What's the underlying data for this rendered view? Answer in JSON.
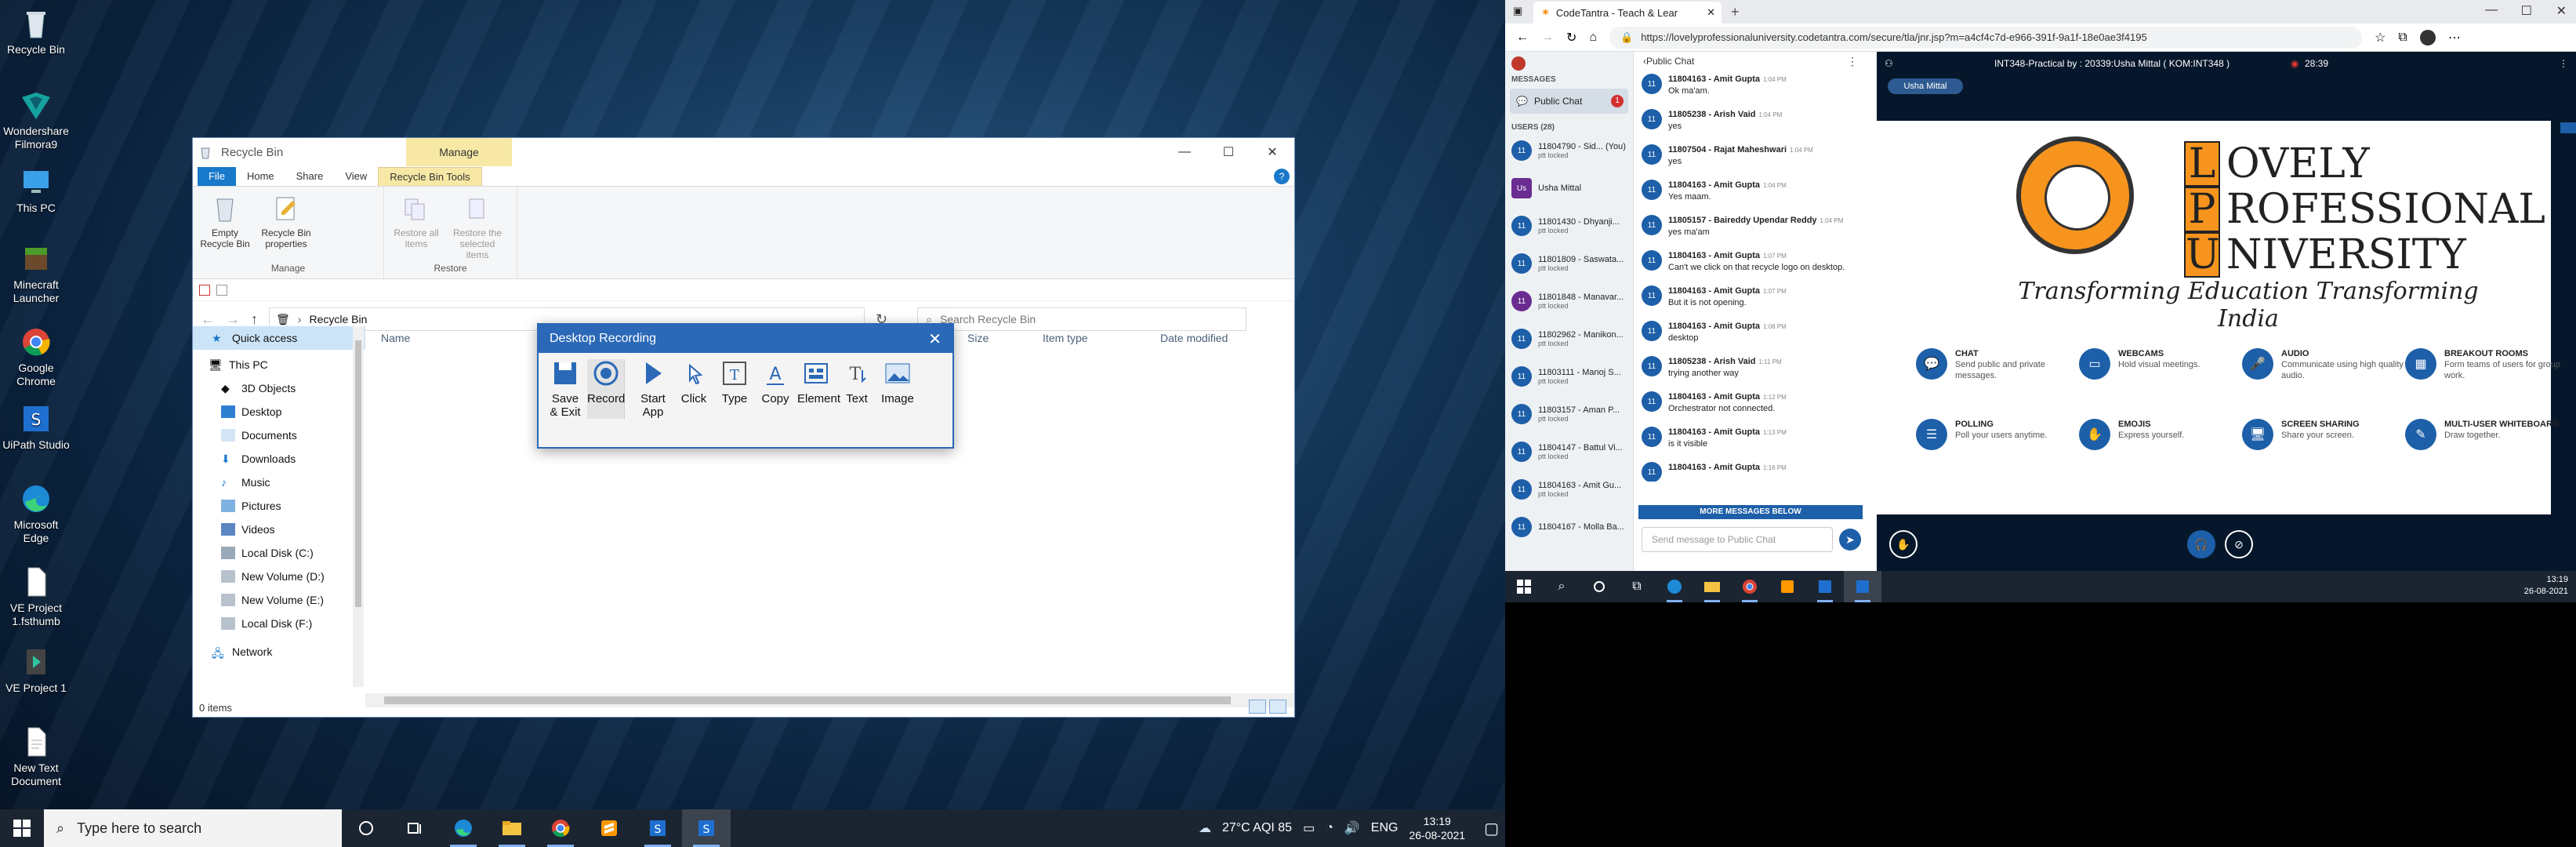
{
  "desktop": {
    "icons": [
      {
        "label": "Recycle Bin"
      },
      {
        "label": "Wondershare Filmora9"
      },
      {
        "label": "This PC"
      },
      {
        "label": "Minecraft Launcher"
      },
      {
        "label": "Google Chrome"
      },
      {
        "label": "UiPath Studio"
      },
      {
        "label": "Microsoft Edge"
      },
      {
        "label": "VE Project 1.fsthumb"
      },
      {
        "label": "VE Project 1"
      },
      {
        "label": "New Text Document"
      }
    ]
  },
  "explorer": {
    "title": "Recycle Bin",
    "manage_tab": "Manage",
    "tabs": [
      "File",
      "Home",
      "Share",
      "View",
      "Recycle Bin Tools"
    ],
    "ribbon": {
      "manage_group": {
        "label": "Manage",
        "empty": "Empty Recycle Bin",
        "props": "Recycle Bin properties"
      },
      "restore_group": {
        "label": "Restore",
        "restore_all": "Restore all items",
        "restore_sel": "Restore the selected items"
      }
    },
    "address": "Recycle Bin",
    "search_placeholder": "Search Recycle Bin",
    "nav": [
      "Quick access",
      "This PC",
      "3D Objects",
      "Desktop",
      "Documents",
      "Downloads",
      "Music",
      "Pictures",
      "Videos",
      "Local Disk (C:)",
      "New Volume (D:)",
      "New Volume (E:)",
      "Local Disk (F:)",
      "Network"
    ],
    "columns": [
      "Name",
      "Size",
      "Item type",
      "Date modified"
    ],
    "status": "0 items"
  },
  "recorder": {
    "title": "Desktop Recording",
    "tools": [
      "Save & Exit",
      "Record",
      "Start App",
      "Click",
      "Type",
      "Copy",
      "Element",
      "Text",
      "Image"
    ]
  },
  "taskbar_left": {
    "search_placeholder": "Type here to search",
    "weather": "27°C AQI 85",
    "lang": "ENG",
    "time": "13:19",
    "date": "26-08-2021"
  },
  "browser": {
    "tab_title": "CodeTantra - Teach & Lear",
    "url": "https://lovelyprofessionaluniversity.codetantra.com/secure/tla/jnr.jsp?m=a4cf4c7d-e966-391f-9a1f-18e0ae3f4195"
  },
  "meeting": {
    "messages_label": "MESSAGES",
    "public_chat": "Public Chat",
    "unread": "1",
    "users_label": "USERS (28)",
    "users": [
      {
        "initials": "11",
        "name": "11804790 - Sid... (You)",
        "sub": "ptt locked"
      },
      {
        "initials": "Us",
        "name": "Usha Mittal",
        "sub": ""
      },
      {
        "initials": "11",
        "name": "11801430 - Dhyanji...",
        "sub": "ptt locked"
      },
      {
        "initials": "11",
        "name": "11801809 - Saswata...",
        "sub": "ptt locked"
      },
      {
        "initials": "11",
        "name": "11801848 - Manavar...",
        "sub": "ptt locked"
      },
      {
        "initials": "11",
        "name": "11802962 - Manikon...",
        "sub": "ptt locked"
      },
      {
        "initials": "11",
        "name": "11803111 - Manoj S...",
        "sub": "ptt locked"
      },
      {
        "initials": "11",
        "name": "11803157 - Aman P...",
        "sub": "ptt locked"
      },
      {
        "initials": "11",
        "name": "11804147 - Battul Vi...",
        "sub": "ptt locked"
      },
      {
        "initials": "11",
        "name": "11804163 - Amit Gu...",
        "sub": "ptt locked"
      },
      {
        "initials": "11",
        "name": "11804167 - Molla Ba...",
        "sub": ""
      }
    ],
    "chat_header": "Public Chat",
    "messages": [
      {
        "name": "11804163 - Amit Gupta",
        "time": "1:04 PM",
        "text": "Ok ma'am."
      },
      {
        "name": "11805238 - Arish Vaid",
        "time": "1:04 PM",
        "text": "yes"
      },
      {
        "name": "11807504 - Rajat Maheshwari",
        "time": "1:04 PM",
        "text": "yes"
      },
      {
        "name": "11804163 - Amit Gupta",
        "time": "1:04 PM",
        "text": "Yes maam."
      },
      {
        "name": "11805157 - Baireddy Upendar Reddy",
        "time": "1:04 PM",
        "text": "yes ma'am"
      },
      {
        "name": "11804163 - Amit Gupta",
        "time": "1:07 PM",
        "text": "Can't we click on that recycle logo on desktop."
      },
      {
        "name": "11804163 - Amit Gupta",
        "time": "1:07 PM",
        "text": "But it is not opening."
      },
      {
        "name": "11804163 - Amit Gupta",
        "time": "1:08 PM",
        "text": "desktop"
      },
      {
        "name": "11805238 - Arish Vaid",
        "time": "1:11 PM",
        "text": "trying another way"
      },
      {
        "name": "11804163 - Amit Gupta",
        "time": "1:12 PM",
        "text": "Orchestrator not connected."
      },
      {
        "name": "11804163 - Amit Gupta",
        "time": "1:13 PM",
        "text": "is it visible"
      },
      {
        "name": "11804163 - Amit Gupta",
        "time": "1:16 PM",
        "text": ""
      }
    ],
    "more_messages": "MORE MESSAGES BELOW",
    "input_placeholder": "Send message to Public Chat",
    "session_title": "INT348-Practical by : 20339:Usha Mittal ( KOM:INT348 )",
    "timer": "28:39",
    "presenter": "Usha Mittal",
    "slide": {
      "words": [
        {
          "letter": "L",
          "rest": "OVELY"
        },
        {
          "letter": "P",
          "rest": "ROFESSIONAL"
        },
        {
          "letter": "U",
          "rest": "NIVERSITY"
        }
      ],
      "tagline": "Transforming Education Transforming India",
      "features": [
        {
          "title": "CHAT",
          "desc": "Send public and private messages."
        },
        {
          "title": "WEBCAMS",
          "desc": "Hold visual meetings."
        },
        {
          "title": "AUDIO",
          "desc": "Communicate using high quality audio."
        },
        {
          "title": "BREAKOUT ROOMS",
          "desc": "Form teams of users for group work."
        },
        {
          "title": "POLLING",
          "desc": "Poll your users anytime."
        },
        {
          "title": "EMOJIS",
          "desc": "Express yourself."
        },
        {
          "title": "SCREEN SHARING",
          "desc": "Share your screen."
        },
        {
          "title": "MULTI-USER WHITEBOARD",
          "desc": "Draw together."
        }
      ]
    }
  },
  "taskbar_right": {
    "time": "13:19",
    "date": "26-08-2021"
  }
}
